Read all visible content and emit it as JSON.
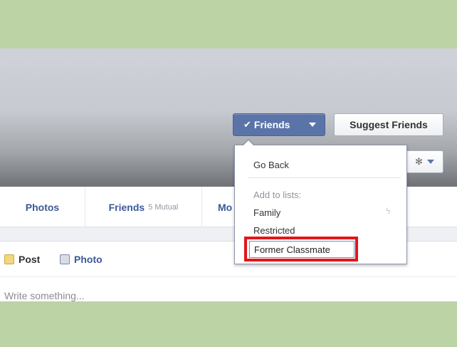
{
  "header": {
    "friends_button": {
      "label": "Friends",
      "check_glyph": "✔"
    },
    "suggest_button": {
      "label": "Suggest Friends"
    },
    "gear_button": {
      "icon": "gear-icon",
      "glyph": "✻"
    }
  },
  "tabs": {
    "photos": {
      "label": "Photos"
    },
    "friends": {
      "label": "Friends",
      "sub": "5 Mutual"
    },
    "more": {
      "label": "Mo"
    }
  },
  "composer": {
    "post_label": "Post",
    "photo_label": "Photo",
    "placeholder": "Write something..."
  },
  "menu": {
    "go_back": "Go Back",
    "add_to_lists_header": "Add to lists:",
    "items": [
      "Family",
      "Restricted"
    ],
    "new_list_value": "Former Classmate",
    "lightning_glyph": "ϟ"
  },
  "colors": {
    "green_band": "#bcd3a6",
    "fb_blue": "#3b5998",
    "friends_button_bg": "#5b74a8",
    "highlight_red": "#e4151b"
  }
}
